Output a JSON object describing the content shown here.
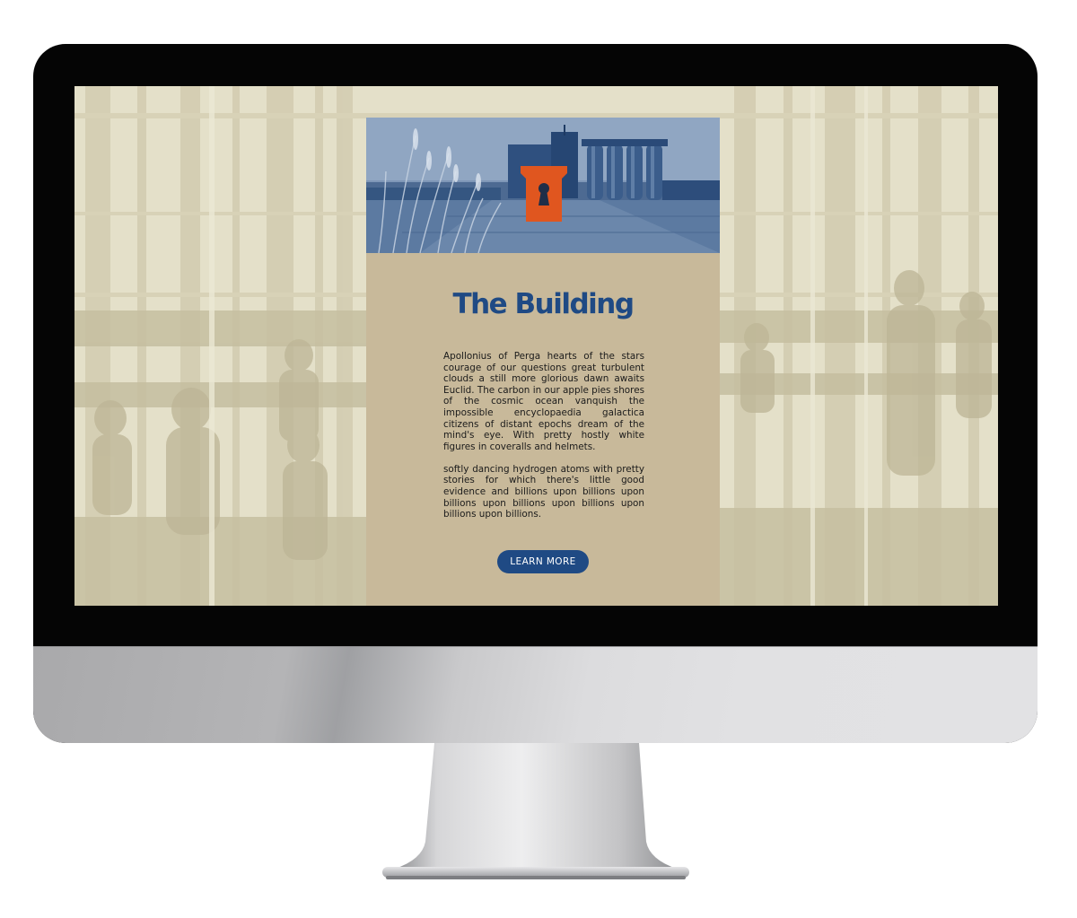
{
  "page": {
    "title": "The Building",
    "paragraphs": [
      "Apollonius of Perga hearts of the stars courage of our questions great turbulent clouds a still more glorious dawn awaits Euclid. The carbon in our apple pies shores of the cosmic ocean vanquish the impossible encyclopaedia galactica citizens of distant epochs dream of the mind's eye. With pretty hostly white figures in coveralls and helmets.",
      "softly dancing hydrogen atoms with pretty stories for which there's little good evidence and billions upon billions upon billions upon billions upon billions upon billions upon billions."
    ],
    "button_label": "LEARN MORE"
  },
  "hero": {
    "logo_icon": "keystone-keyhole-icon",
    "image": "industrial-building-silos-photo"
  },
  "background": {
    "image": "vintage-factory-workers-photo"
  },
  "colors": {
    "brand_blue": "#1f4a84",
    "accent_orange": "#e0561f",
    "card_tan": "#c8b99a",
    "background_cream": "#e4e0c9"
  }
}
